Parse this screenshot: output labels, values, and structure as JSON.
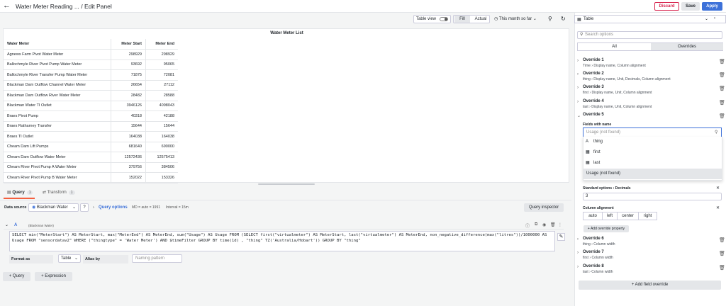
{
  "topbar": {
    "back_icon": "arrow-left-icon",
    "breadcrumb": "Water Meter Reading ... / Edit Panel",
    "discard": "Discard",
    "save": "Save",
    "apply": "Apply"
  },
  "toolbar": {
    "table_view": "Table view",
    "fill": "Fill",
    "actual": "Actual",
    "time_range": "This month so far"
  },
  "viz": {
    "type": "Table",
    "search_placeholder": "Search options",
    "tab_all": "All",
    "tab_overrides": "Overrides"
  },
  "panel": {
    "title": "Water Meter List",
    "columns": [
      "Water Meter",
      "Meter Start",
      "Meter End"
    ],
    "rows": [
      [
        "Agnews Farm Pivot Water Meter",
        "298929",
        "298929"
      ],
      [
        "Ballochmyle River Pivot Pump Water Meter",
        "93692",
        "95065"
      ],
      [
        "Ballochmyle River Transfer Pump Water Meter",
        "71875",
        "72081"
      ],
      [
        "Blackman Dam Outflow Channel Water Meter",
        "26654",
        "27112"
      ],
      [
        "Blackman Dam Outflow River Water Meter",
        "28482",
        "28588"
      ],
      [
        "Blackman Water TI Outlet",
        "3946126",
        "4098043"
      ],
      [
        "Braes Pivot Pump",
        "40318",
        "42188"
      ],
      [
        "Braes Ratharney Transfer",
        "15644",
        "15644"
      ],
      [
        "Braes TI Outlet",
        "164038",
        "164038"
      ],
      [
        "Cheam Dam Lift Pumps",
        "681640",
        "690000"
      ],
      [
        "Cheam Dam Outflow Water Meter",
        "12572436",
        "12575413"
      ],
      [
        "Cheam River Pivot Pump A Water Meter",
        "379756",
        "384506"
      ],
      [
        "Cheam River Pivot Pump B Water Meter",
        "152022",
        "153326"
      ]
    ]
  },
  "query": {
    "tab_query": "Query",
    "tab_query_count": "1",
    "tab_transform": "Transform",
    "tab_transform_count": "1",
    "data_source_label": "Data source",
    "data_source": "Blackman Water",
    "query_options": "Query options",
    "md_info": "MD = auto = 1991",
    "interval_info": "Interval = 15m",
    "inspector": "Query inspector",
    "ref_id": "A",
    "ref_ds": "(Blackman Water)",
    "sql": "SELECT min(\"MeterStart\") AS MeterStart, max(\"MeterEnd\") AS MeterEnd, sum(\"Usage\") AS Usage FROM (SELECT first(\"virtualmeter\") AS MeterStart, last(\"virtualmeter\") AS MeterEnd, non_negative_difference(max(\"litres\"))/1000000 AS Usage FROM \"sensordatav2\" WHERE (\"thingtype\" = 'Water Meter') AND $timeFilter GROUP BY time(1d) , \"thing\" TZ('Australia/Hobart')) GROUP BY \"thing\"",
    "format_label": "Format as",
    "format_value": "Table",
    "alias_label": "Alias by",
    "alias_placeholder": "Naming pattern",
    "add_query": "Query",
    "add_expression": "Expression"
  },
  "overrides": [
    {
      "title": "Override 1",
      "field": "Time",
      "props": "Display name, Column alignment"
    },
    {
      "title": "Override 2",
      "field": "thing",
      "props": "Display name, Unit, Decimals, Column alignment"
    },
    {
      "title": "Override 3",
      "field": "first",
      "props": "Display name, Unit, Column alignment"
    },
    {
      "title": "Override 4",
      "field": "last",
      "props": "Display name, Unit, Column alignment"
    },
    {
      "title": "Override 5"
    },
    {
      "title": "Override 6",
      "field": "thing",
      "props": "Column width"
    },
    {
      "title": "Override 7",
      "field": "first",
      "props": "Column width"
    },
    {
      "title": "Override 8",
      "field": "last",
      "props": "Column width"
    }
  ],
  "override5": {
    "fields_label": "Fields with name",
    "fields_placeholder": "Usage (not found)",
    "options": [
      "thing",
      "first",
      "last",
      "Usage (not found)"
    ],
    "std_options": "Standard options",
    "decimals": "Decimals",
    "decimals_value": "3",
    "col_align": "Column alignment",
    "align_opts": [
      "auto",
      "left",
      "center",
      "right"
    ],
    "add_prop": "Add override property"
  },
  "add_field_override": "Add field override"
}
